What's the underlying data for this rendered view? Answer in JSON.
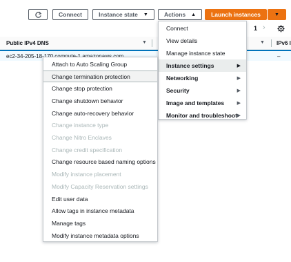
{
  "toolbar": {
    "refresh_icon": "refresh-icon",
    "connect": "Connect",
    "instance_state": "Instance state",
    "actions": "Actions",
    "launch_instances": "Launch instances"
  },
  "pagination": {
    "page": "1"
  },
  "table": {
    "headers": [
      "Public IPv4 DNS",
      "IPv6 I"
    ],
    "row": {
      "dns": "ec2-34-205-18-170.compute-1.amazonaws.com",
      "ipv6": "–"
    }
  },
  "actions_menu": [
    {
      "label": "Connect",
      "submenu": false,
      "bold": false
    },
    {
      "label": "View details",
      "submenu": false,
      "bold": false
    },
    {
      "label": "Manage instance state",
      "submenu": false,
      "bold": false
    },
    {
      "label": "Instance settings",
      "submenu": true,
      "bold": true,
      "active": true
    },
    {
      "label": "Networking",
      "submenu": true,
      "bold": true
    },
    {
      "label": "Security",
      "submenu": true,
      "bold": true
    },
    {
      "label": "Image and templates",
      "submenu": true,
      "bold": true
    },
    {
      "label": "Monitor and troubleshoot",
      "submenu": true,
      "bold": true
    }
  ],
  "instance_settings_menu": [
    {
      "label": "Attach to Auto Scaling Group",
      "disabled": false
    },
    {
      "label": "Change termination protection",
      "disabled": false,
      "hovered": true
    },
    {
      "label": "Change stop protection",
      "disabled": false
    },
    {
      "label": "Change shutdown behavior",
      "disabled": false
    },
    {
      "label": "Change auto-recovery behavior",
      "disabled": false
    },
    {
      "label": "Change instance type",
      "disabled": true
    },
    {
      "label": "Change Nitro Enclaves",
      "disabled": true
    },
    {
      "label": "Change credit specification",
      "disabled": true
    },
    {
      "label": "Change resource based naming options",
      "disabled": false
    },
    {
      "label": "Modify instance placement",
      "disabled": true
    },
    {
      "label": "Modify Capacity Reservation settings",
      "disabled": true
    },
    {
      "label": "Edit user data",
      "disabled": false
    },
    {
      "label": "Allow tags in instance metadata",
      "disabled": false
    },
    {
      "label": "Manage tags",
      "disabled": false
    },
    {
      "label": "Modify instance metadata options",
      "disabled": false
    }
  ],
  "colors": {
    "accent": "#ec7211",
    "selected_border": "#0073bb",
    "hover_bg": "#f2f3f3",
    "active_bg": "#eaeded",
    "disabled_text": "#aab7b8"
  }
}
